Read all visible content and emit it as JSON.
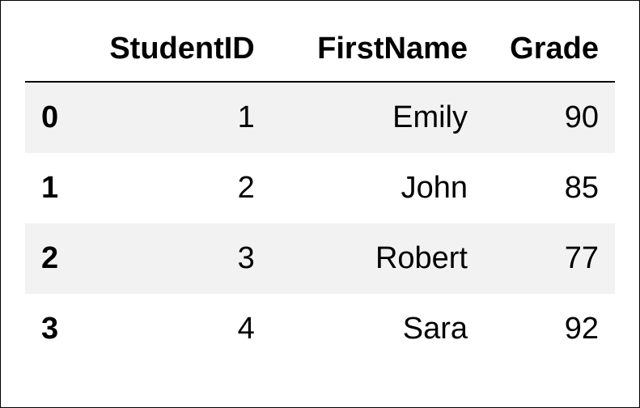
{
  "chart_data": {
    "type": "table",
    "columns": [
      "StudentID",
      "FirstName",
      "Grade"
    ],
    "index": [
      "0",
      "1",
      "2",
      "3"
    ],
    "rows": [
      {
        "StudentID": 1,
        "FirstName": "Emily",
        "Grade": 90
      },
      {
        "StudentID": 2,
        "FirstName": "John",
        "Grade": 85
      },
      {
        "StudentID": 3,
        "FirstName": "Robert",
        "Grade": 77
      },
      {
        "StudentID": 4,
        "FirstName": "Sara",
        "Grade": 92
      }
    ]
  }
}
